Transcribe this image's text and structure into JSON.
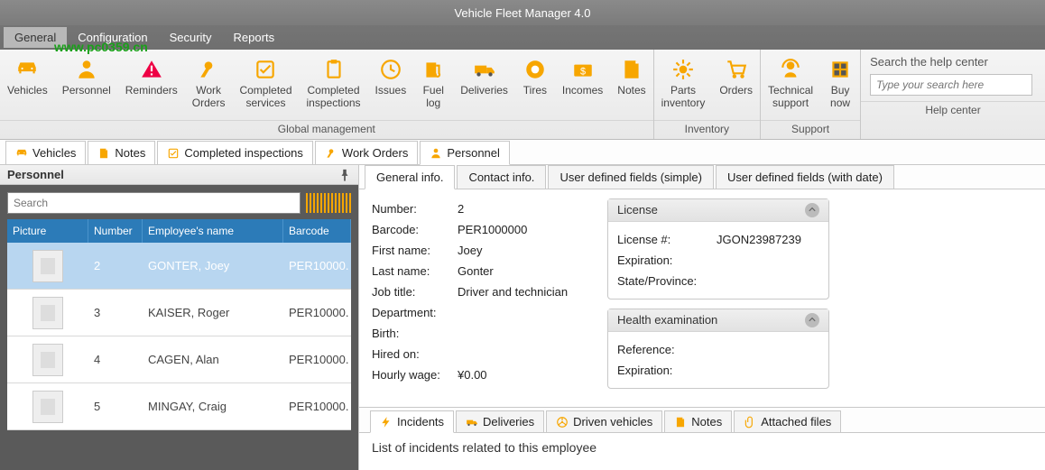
{
  "app": {
    "title": "Vehicle Fleet Manager 4.0",
    "watermark": "www.pc0359.cn"
  },
  "menu": {
    "items": [
      "General",
      "Configuration",
      "Security",
      "Reports"
    ],
    "active": 0
  },
  "ribbon": {
    "groups": [
      {
        "label": "Global management",
        "buttons": [
          {
            "key": "vehicles",
            "label": "Vehicles"
          },
          {
            "key": "personnel",
            "label": "Personnel"
          },
          {
            "key": "reminders",
            "label": "Reminders"
          },
          {
            "key": "work-orders",
            "label": "Work\nOrders"
          },
          {
            "key": "completed-services",
            "label": "Completed\nservices"
          },
          {
            "key": "completed-inspections",
            "label": "Completed\ninspections"
          },
          {
            "key": "issues",
            "label": "Issues"
          },
          {
            "key": "fuel-log",
            "label": "Fuel\nlog"
          },
          {
            "key": "deliveries",
            "label": "Deliveries"
          },
          {
            "key": "tires",
            "label": "Tires"
          },
          {
            "key": "incomes",
            "label": "Incomes"
          },
          {
            "key": "notes",
            "label": "Notes"
          }
        ]
      },
      {
        "label": "Inventory",
        "buttons": [
          {
            "key": "parts-inventory",
            "label": "Parts\ninventory"
          },
          {
            "key": "orders",
            "label": "Orders"
          }
        ]
      },
      {
        "label": "Support",
        "buttons": [
          {
            "key": "tech-support",
            "label": "Technical\nsupport"
          },
          {
            "key": "buy-now",
            "label": "Buy\nnow"
          }
        ]
      }
    ],
    "help": {
      "label": "Help center",
      "title": "Search the help center",
      "placeholder": "Type your search here"
    }
  },
  "openTabs": [
    {
      "icon": "car",
      "label": "Vehicles"
    },
    {
      "icon": "note",
      "label": "Notes"
    },
    {
      "icon": "check",
      "label": "Completed inspections"
    },
    {
      "icon": "wrench",
      "label": "Work Orders"
    },
    {
      "icon": "person",
      "label": "Personnel",
      "active": true
    }
  ],
  "leftPanel": {
    "title": "Personnel",
    "searchPlaceholder": "Search",
    "columns": [
      "Picture",
      "Number",
      "Employee's name",
      "Barcode"
    ],
    "rows": [
      {
        "number": "2",
        "name": "GONTER, Joey",
        "barcode": "PER10000.",
        "selected": true
      },
      {
        "number": "3",
        "name": "KAISER, Roger",
        "barcode": "PER10000."
      },
      {
        "number": "4",
        "name": "CAGEN, Alan",
        "barcode": "PER10000."
      },
      {
        "number": "5",
        "name": "MINGAY, Craig",
        "barcode": "PER10000."
      }
    ]
  },
  "detailTabs": [
    "General info.",
    "Contact info.",
    "User defined fields (simple)",
    "User defined fields (with date)"
  ],
  "detail": {
    "fields": [
      {
        "label": "Number:",
        "value": "2"
      },
      {
        "label": "Barcode:",
        "value": "PER1000000"
      },
      {
        "label": "First name:",
        "value": "Joey"
      },
      {
        "label": "Last name:",
        "value": "Gonter"
      },
      {
        "label": "Job title:",
        "value": "Driver and technician"
      },
      {
        "label": "Department:",
        "value": ""
      },
      {
        "label": "Birth:",
        "value": ""
      },
      {
        "label": "Hired on:",
        "value": ""
      },
      {
        "label": "Hourly wage:",
        "value": "¥0.00"
      }
    ],
    "license": {
      "title": "License",
      "fields": [
        {
          "label": "License #:",
          "value": "JGON23987239"
        },
        {
          "label": "Expiration:",
          "value": ""
        },
        {
          "label": "State/Province:",
          "value": ""
        }
      ]
    },
    "health": {
      "title": "Health examination",
      "fields": [
        {
          "label": "Reference:",
          "value": ""
        },
        {
          "label": "Expiration:",
          "value": ""
        }
      ]
    }
  },
  "subTabs": [
    {
      "icon": "bolt",
      "label": "Incidents",
      "active": true
    },
    {
      "icon": "truck",
      "label": "Deliveries"
    },
    {
      "icon": "steer",
      "label": "Driven vehicles"
    },
    {
      "icon": "note",
      "label": "Notes"
    },
    {
      "icon": "clip",
      "label": "Attached files"
    }
  ],
  "subHead": "List of incidents related to this employee"
}
